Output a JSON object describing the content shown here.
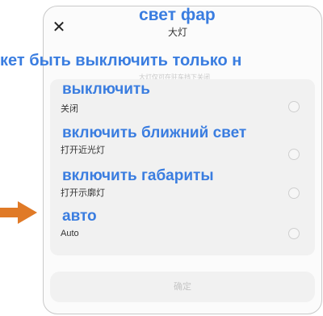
{
  "dialog": {
    "title_cn": "大灯",
    "title_ru": "свет фар",
    "subtitle_cn": "大灯仅可在驻车挡下关闭",
    "notice_ru": "кет быть выключить только н",
    "close_icon": "close-icon"
  },
  "options": [
    {
      "label_ru": "выключить",
      "label_cn": "关闭"
    },
    {
      "label_ru": "включить ближний свет",
      "label_cn": "打开近光灯"
    },
    {
      "label_ru": "включить габариты",
      "label_cn": "打开示廓灯"
    },
    {
      "label_ru": "авто",
      "label_cn": "Auto"
    }
  ],
  "confirm_label": "确定",
  "colors": {
    "annotation": "#3a7de0",
    "arrow": "#e07a27"
  }
}
